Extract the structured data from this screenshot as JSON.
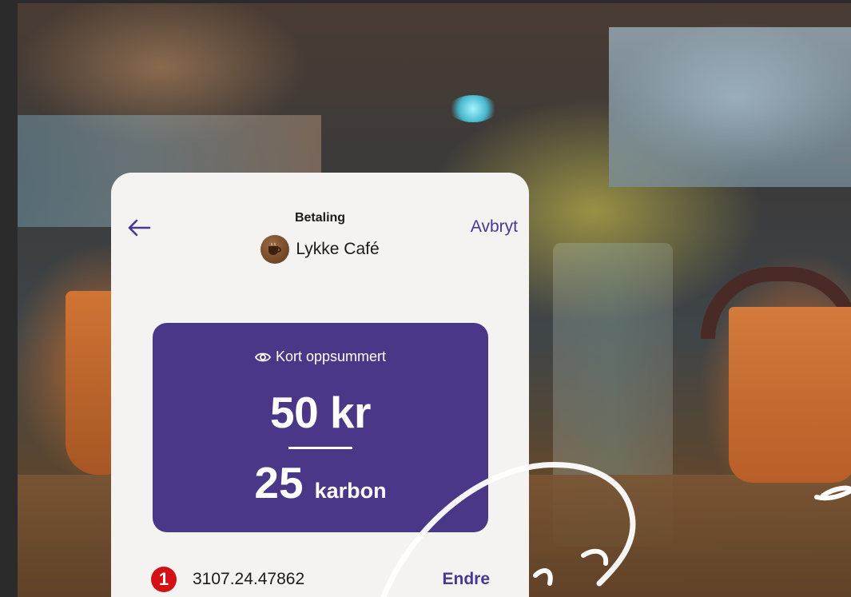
{
  "header": {
    "title": "Betaling",
    "cancel_label": "Avbryt",
    "merchant_name": "Lykke Café"
  },
  "summary": {
    "label": "Kort oppsummert",
    "amount": "50 kr",
    "carbon_value": "25",
    "carbon_unit": "karbon"
  },
  "account": {
    "number": "3107.24.47862",
    "change_label": "Endre"
  },
  "colors": {
    "accent": "#4a3791",
    "summary_bg": "#4a3788",
    "card_bg": "#f4f3f1",
    "bank_red": "#d40f16"
  },
  "icons": {
    "back": "arrow-left-icon",
    "summary": "eye-icon",
    "merchant": "coffee-cup-icon",
    "bank": "bank-logo-icon"
  }
}
